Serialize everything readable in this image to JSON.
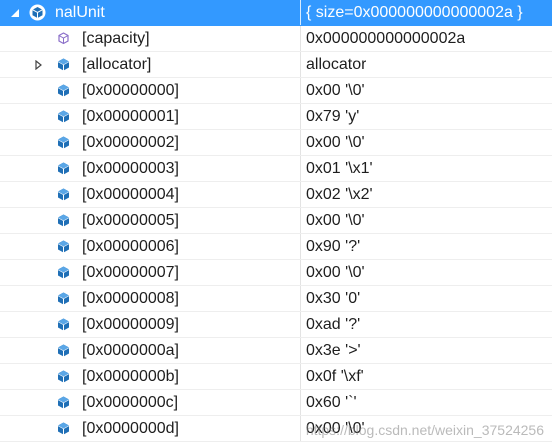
{
  "root": {
    "name": "nalUnit",
    "value": "{ size=0x000000000000002a }"
  },
  "rows": [
    {
      "name": "[capacity]",
      "value": "0x000000000000002a",
      "icon": "property-icon",
      "expandable": false
    },
    {
      "name": "[allocator]",
      "value": "allocator",
      "icon": "object-icon",
      "expandable": true
    },
    {
      "name": "[0x00000000]",
      "value": "0x00 '\\0'",
      "icon": "object-icon",
      "expandable": false
    },
    {
      "name": "[0x00000001]",
      "value": "0x79 'y'",
      "icon": "object-icon",
      "expandable": false
    },
    {
      "name": "[0x00000002]",
      "value": "0x00 '\\0'",
      "icon": "object-icon",
      "expandable": false
    },
    {
      "name": "[0x00000003]",
      "value": "0x01 '\\x1'",
      "icon": "object-icon",
      "expandable": false
    },
    {
      "name": "[0x00000004]",
      "value": "0x02 '\\x2'",
      "icon": "object-icon",
      "expandable": false
    },
    {
      "name": "[0x00000005]",
      "value": "0x00 '\\0'",
      "icon": "object-icon",
      "expandable": false
    },
    {
      "name": "[0x00000006]",
      "value": "0x90 '?'",
      "icon": "object-icon",
      "expandable": false
    },
    {
      "name": "[0x00000007]",
      "value": "0x00 '\\0'",
      "icon": "object-icon",
      "expandable": false
    },
    {
      "name": "[0x00000008]",
      "value": "0x30 '0'",
      "icon": "object-icon",
      "expandable": false
    },
    {
      "name": "[0x00000009]",
      "value": "0xad '?'",
      "icon": "object-icon",
      "expandable": false
    },
    {
      "name": "[0x0000000a]",
      "value": "0x3e '>'",
      "icon": "object-icon",
      "expandable": false
    },
    {
      "name": "[0x0000000b]",
      "value": "0x0f '\\xf'",
      "icon": "object-icon",
      "expandable": false
    },
    {
      "name": "[0x0000000c]",
      "value": "0x60 '`'",
      "icon": "object-icon",
      "expandable": false
    },
    {
      "name": "[0x0000000d]",
      "value": "0x00 '\\0'",
      "icon": "object-icon",
      "expandable": false
    }
  ],
  "watermark": "https://blog.csdn.net/weixin_37524256",
  "colors": {
    "selection": "#3399ff",
    "icon_blue": "#1f6fb6",
    "icon_purple": "#8b6fc9"
  }
}
